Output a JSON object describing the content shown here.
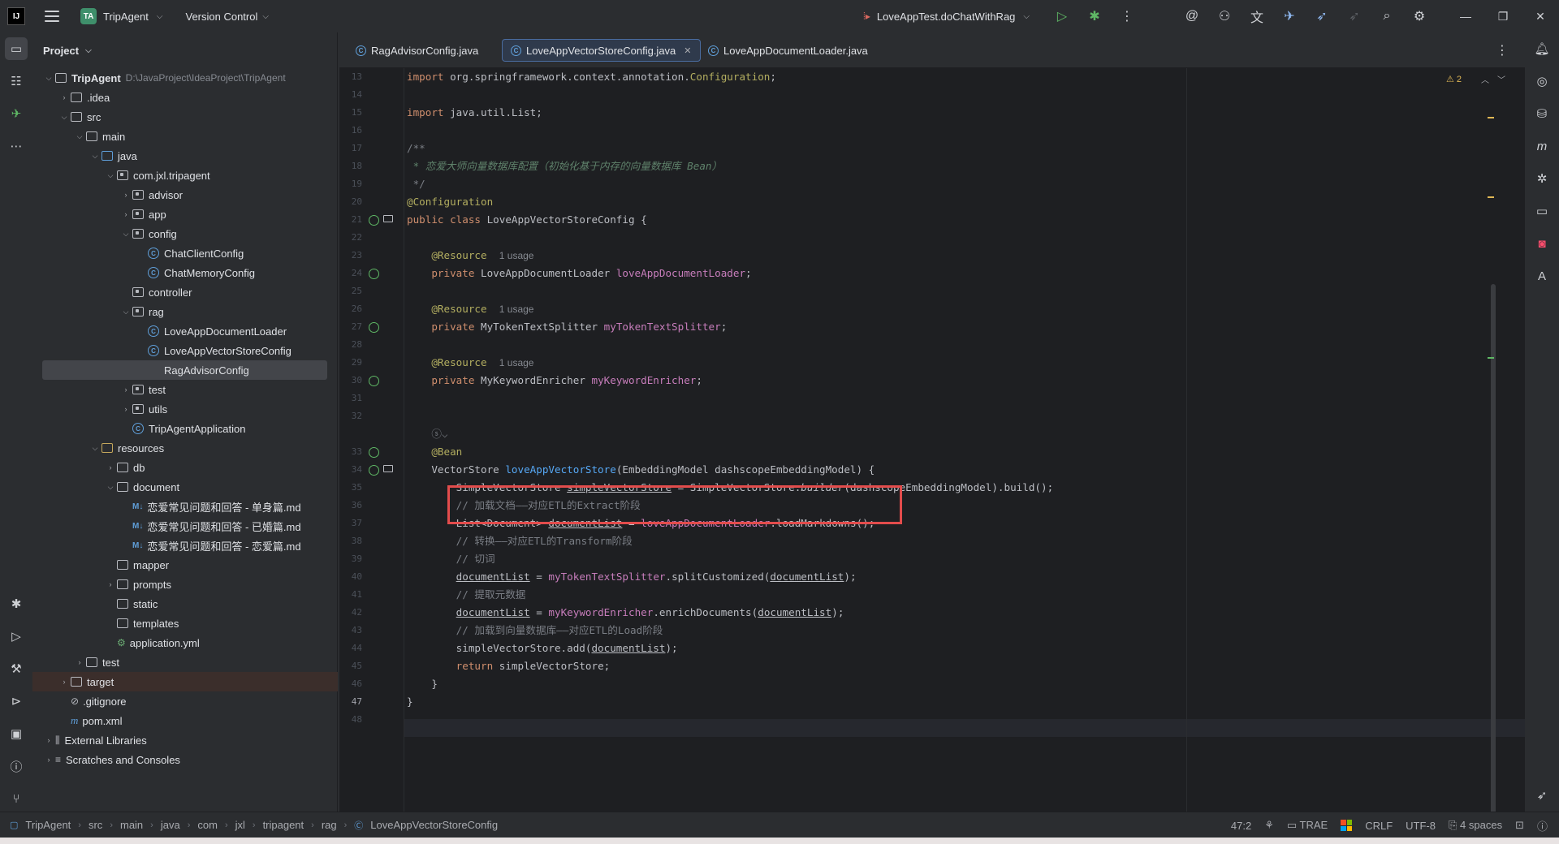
{
  "titlebar": {
    "logo": "IJ",
    "project_badge": "TA",
    "project_name": "TripAgent",
    "vcs_label": "Version Control",
    "run_config": "LoveAppTest.doChatWithRag",
    "icons": [
      "run-icon",
      "debug-icon",
      "more-icon",
      "ai-spiral-icon",
      "add-user-icon",
      "translate-icon",
      "plugin-icon",
      "rocket-icon",
      "disabled-rocket-icon",
      "search-icon",
      "settings-icon"
    ],
    "window_controls": [
      "minimize",
      "restore",
      "close"
    ]
  },
  "project_panel": {
    "title": "Project",
    "tree": [
      {
        "label": "TripAgent",
        "path": "D:\\JavaProject\\IdeaProject\\TripAgent",
        "kind": "module"
      },
      {
        "label": ".idea",
        "kind": "folder"
      },
      {
        "label": "src",
        "kind": "folder"
      },
      {
        "label": "main",
        "kind": "folder"
      },
      {
        "label": "java",
        "kind": "source-folder"
      },
      {
        "label": "com.jxl.tripagent",
        "kind": "package"
      },
      {
        "label": "advisor",
        "kind": "package"
      },
      {
        "label": "app",
        "kind": "package"
      },
      {
        "label": "config",
        "kind": "package"
      },
      {
        "label": "ChatClientConfig",
        "kind": "class"
      },
      {
        "label": "ChatMemoryConfig",
        "kind": "class"
      },
      {
        "label": "controller",
        "kind": "package"
      },
      {
        "label": "rag",
        "kind": "package"
      },
      {
        "label": "LoveAppDocumentLoader",
        "kind": "class"
      },
      {
        "label": "LoveAppVectorStoreConfig",
        "kind": "class"
      },
      {
        "label": "RagAdvisorConfig",
        "kind": "class"
      },
      {
        "label": "test",
        "kind": "package"
      },
      {
        "label": "utils",
        "kind": "package"
      },
      {
        "label": "TripAgentApplication",
        "kind": "class"
      },
      {
        "label": "resources",
        "kind": "resource-folder"
      },
      {
        "label": "db",
        "kind": "folder"
      },
      {
        "label": "document",
        "kind": "folder"
      },
      {
        "label": "恋爱常见问题和回答 - 单身篇.md",
        "kind": "md"
      },
      {
        "label": "恋爱常见问题和回答 - 已婚篇.md",
        "kind": "md"
      },
      {
        "label": "恋爱常见问题和回答 - 恋爱篇.md",
        "kind": "md"
      },
      {
        "label": "mapper",
        "kind": "folder"
      },
      {
        "label": "prompts",
        "kind": "folder"
      },
      {
        "label": "static",
        "kind": "folder"
      },
      {
        "label": "templates",
        "kind": "folder"
      },
      {
        "label": "application.yml",
        "kind": "yaml"
      },
      {
        "label": "test",
        "kind": "folder"
      },
      {
        "label": "target",
        "kind": "folder"
      },
      {
        "label": ".gitignore",
        "kind": "git"
      },
      {
        "label": "pom.xml",
        "kind": "maven"
      },
      {
        "label": "External Libraries",
        "kind": "lib"
      },
      {
        "label": "Scratches and Consoles",
        "kind": "scratch"
      }
    ]
  },
  "tabs": [
    {
      "label": "RagAdvisorConfig.java",
      "active": false
    },
    {
      "label": "LoveAppVectorStoreConfig.java",
      "active": true
    },
    {
      "label": "LoveAppDocumentLoader.java",
      "active": false
    }
  ],
  "editor": {
    "warning_count": "2",
    "usage_label": "1 usage",
    "line_numbers": [
      "13",
      "14",
      "15",
      "16",
      "17",
      "18",
      "19",
      "20",
      "21",
      "22",
      "23",
      "24",
      "25",
      "26",
      "27",
      "28",
      "29",
      "30",
      "31",
      "32",
      "33",
      "34",
      "35",
      "36",
      "37",
      "38",
      "39",
      "40",
      "41",
      "42",
      "43",
      "44",
      "45",
      "46",
      "47",
      "48"
    ],
    "current_line": "47"
  },
  "statusbar": {
    "breadcrumb": [
      "TripAgent",
      "src",
      "main",
      "java",
      "com",
      "jxl",
      "tripagent",
      "rag",
      "LoveAppVectorStoreConfig"
    ],
    "position": "47:2",
    "trae": "TRAE",
    "line_ending": "CRLF",
    "encoding": "UTF-8",
    "indent": "4 spaces"
  }
}
